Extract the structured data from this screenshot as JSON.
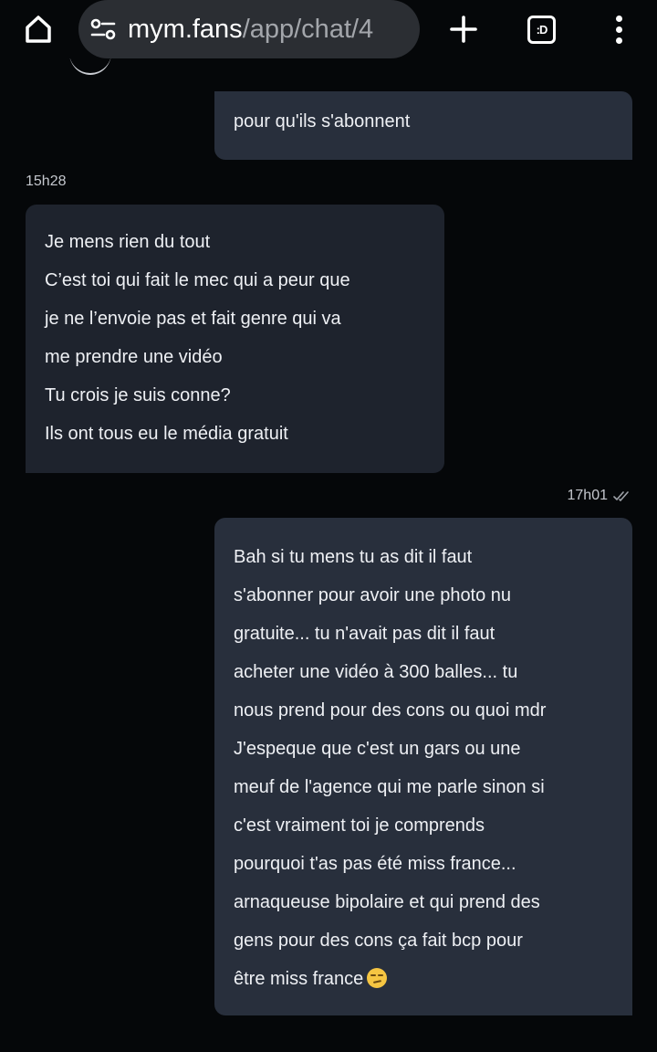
{
  "browser": {
    "url_host": "mym.fans",
    "url_path": "/app/chat/4",
    "tabs_label": ":D"
  },
  "conversation": {
    "messages": [
      {
        "direction": "outgoing",
        "lines": [
          "pour qu'ils s'abonnent"
        ]
      },
      {
        "direction": "incoming",
        "timestamp": "15h28",
        "lines": [
          "Je mens rien du tout",
          "C’est toi qui fait le mec qui a peur que",
          "je ne l’envoie pas et fait genre qui va",
          "me prendre une vidéo",
          "Tu crois je suis conne?",
          "Ils ont tous eu le média gratuit"
        ]
      },
      {
        "direction": "outgoing",
        "timestamp": "17h01",
        "read_status": "double-check-icon",
        "lines": [
          "Bah si tu mens tu as dit il faut",
          "s'abonner pour avoir une photo nu",
          "gratuite... tu n'avait pas dit il faut",
          "acheter une vidéo à 300 balles... tu",
          "nous prend pour des cons ou quoi mdr",
          "J'espeque que c'est un gars ou une",
          "meuf de l'agence qui me parle sinon si",
          "c'est vraiment toi je comprends",
          "pourquoi t'as pas été miss france...",
          "arnaqueuse bipolaire et qui prend des",
          "gens pour des cons ça fait bcp pour",
          "être miss france"
        ],
        "trailing_emoji": "smirking-face-emoji"
      }
    ]
  },
  "colors": {
    "background": "#050709",
    "incoming_bubble": "#1e232d",
    "outgoing_bubble": "#282f3c",
    "url_bar": "#2b2e33"
  }
}
